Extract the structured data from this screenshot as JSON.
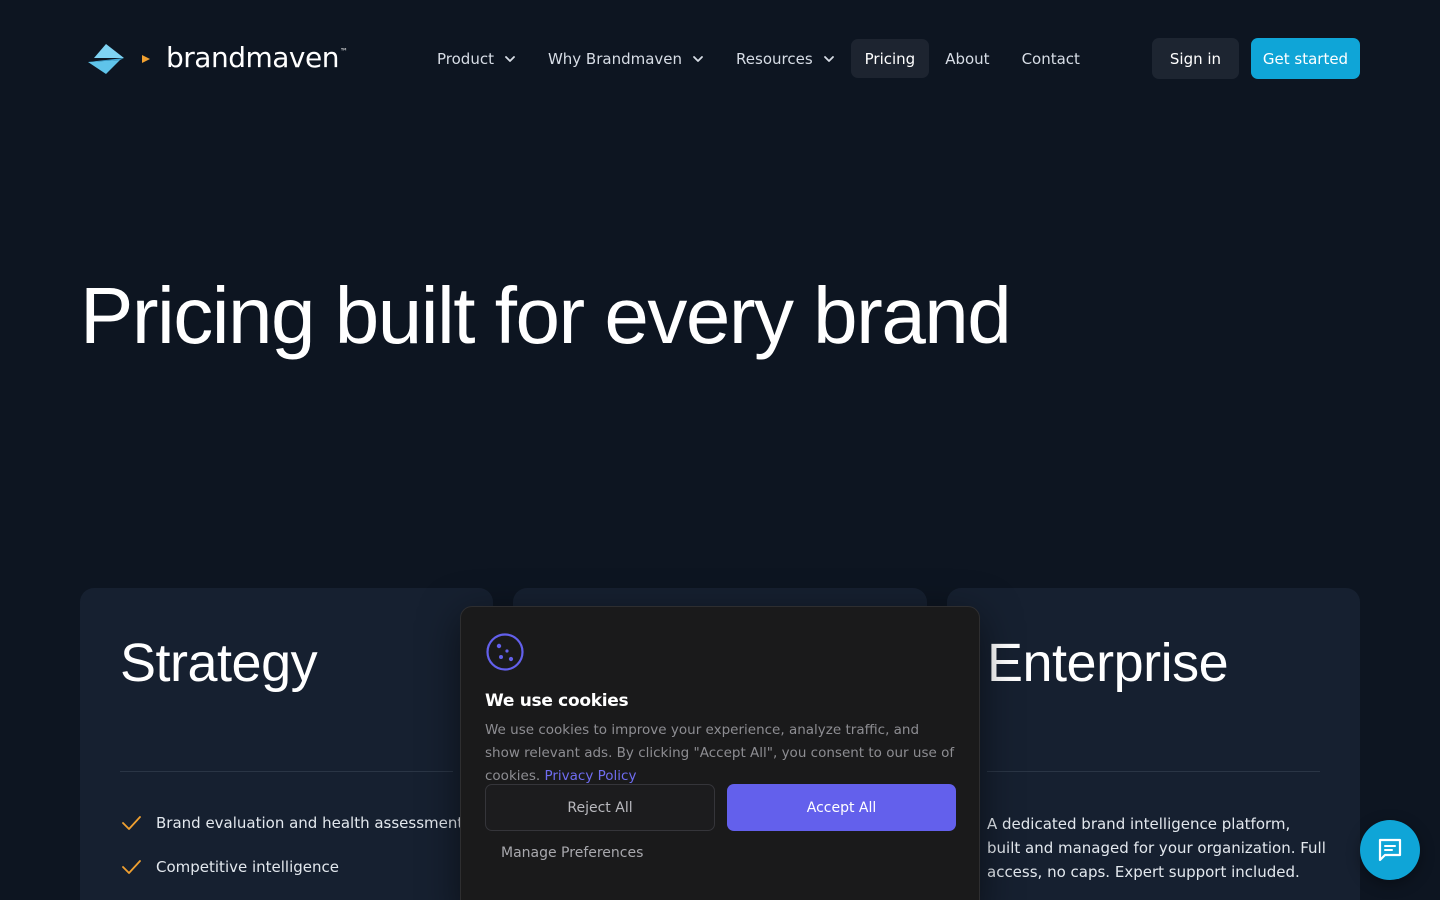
{
  "brand": {
    "name": "brandmaven",
    "trademark": "™"
  },
  "nav": {
    "items": [
      {
        "label": "Product",
        "has_dropdown": true
      },
      {
        "label": "Why Brandmaven",
        "has_dropdown": true
      },
      {
        "label": "Resources",
        "has_dropdown": true
      },
      {
        "label": "Pricing",
        "has_dropdown": false,
        "active": true
      },
      {
        "label": "About",
        "has_dropdown": false
      },
      {
        "label": "Contact",
        "has_dropdown": false
      }
    ],
    "signin_label": "Sign in",
    "get_started_label": "Get started"
  },
  "hero": {
    "title": "Pricing built for every brand"
  },
  "cards": {
    "strategy": {
      "title": "Strategy",
      "features": [
        "Brand evaluation and health assessment",
        "Competitive intelligence"
      ]
    },
    "enterprise": {
      "title": "Enterprise",
      "description": "A dedicated brand intelligence platform, built and managed for your organization. Full access, no caps. Expert support included."
    }
  },
  "cookie": {
    "icon": "cookie-icon",
    "title": "We use cookies",
    "body": "We use cookies to improve your experience, analyze traffic, and show relevant ads. By clicking \"Accept All\", you consent to our use of cookies.",
    "privacy_link": "Privacy Policy",
    "reject_label": "Reject All",
    "accept_label": "Accept All",
    "manage_label": "Manage Preferences"
  },
  "chat": {
    "icon": "chat-icon"
  },
  "colors": {
    "background": "#0d1521",
    "card": "#162030",
    "accent": "#0fa5d7",
    "check": "#f0a030",
    "cookie_accent": "#6360ec"
  }
}
